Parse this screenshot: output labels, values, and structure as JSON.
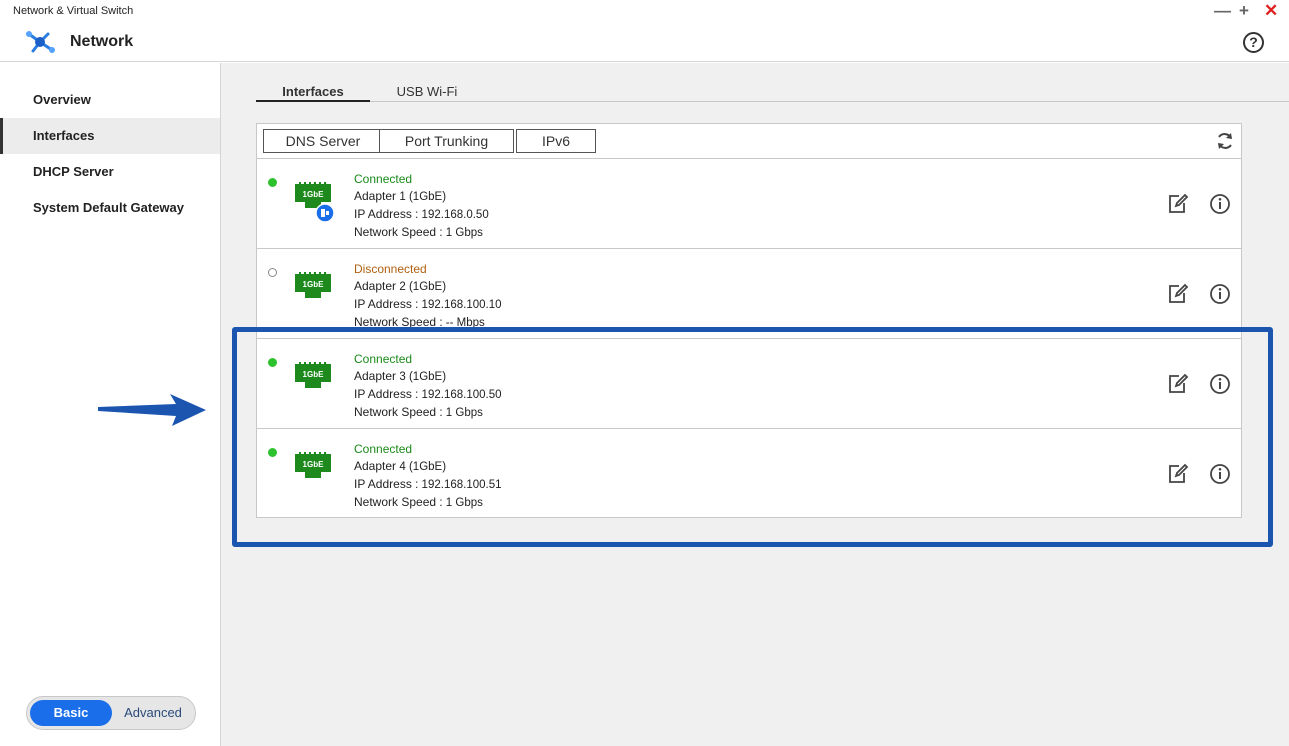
{
  "window": {
    "title": "Network & Virtual Switch",
    "controls": {
      "minimize": "—",
      "maximize": "+",
      "close": "✕"
    }
  },
  "header": {
    "app_title": "Network",
    "help": "?"
  },
  "sidebar": {
    "items": [
      {
        "label": "Overview"
      },
      {
        "label": "Interfaces"
      },
      {
        "label": "DHCP Server"
      },
      {
        "label": "System Default Gateway"
      }
    ],
    "mode": {
      "basic": "Basic",
      "advanced": "Advanced",
      "selected": "Basic"
    }
  },
  "tabs": [
    {
      "label": "Interfaces"
    },
    {
      "label": "USB Wi-Fi"
    }
  ],
  "toolbar": {
    "buttons": [
      {
        "label": "DNS Server"
      },
      {
        "label": "Port Trunking"
      },
      {
        "label": "IPv6"
      }
    ]
  },
  "adapters": [
    {
      "status": "Connected",
      "name": "Adapter",
      "num": "1 (1GbE)",
      "ip_label": "IP Address",
      "ip": ": 192.168.0.50",
      "speed_label": "Network Speed",
      "speed": ": 1 Gbps",
      "nic_label": "1GbE"
    },
    {
      "status": "Disconnected",
      "name": "Adapter",
      "num": "2 (1GbE)",
      "ip_label": "IP Address",
      "ip": ": 192.168.100.10",
      "speed_label": "Network Speed",
      "speed": ": -- Mbps",
      "nic_label": "1GbE"
    },
    {
      "status": "Connected",
      "name": "Adapter",
      "num": "3 (1GbE)",
      "ip_label": "IP Address",
      "ip": ": 192.168.100.50",
      "speed_label": "Network Speed",
      "speed": ": 1 Gbps",
      "nic_label": "1GbE"
    },
    {
      "status": "Connected",
      "name": "Adapter",
      "num": "4 (1GbE)",
      "ip_label": "IP Address",
      "ip": ": 192.168.100.51",
      "speed_label": "Network Speed",
      "speed": ": 1 Gbps",
      "nic_label": "1GbE"
    }
  ],
  "colors": {
    "accent": "#1a6eea",
    "connected": "#1a8a1a",
    "disconnected": "#b06010",
    "nic_green": "#1e8a1e",
    "highlight": "#1c55b0"
  }
}
